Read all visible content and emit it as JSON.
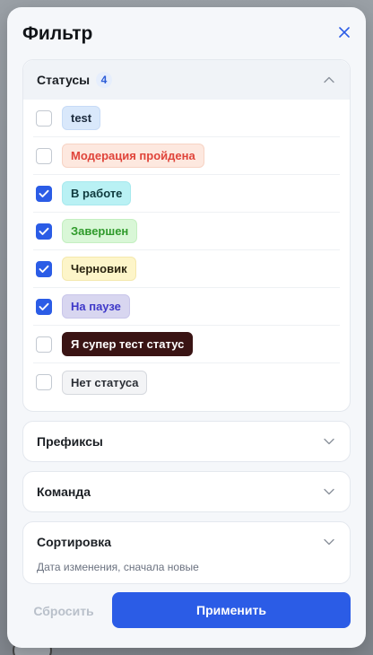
{
  "modal": {
    "title": "Фильтр",
    "close_icon": "close-icon"
  },
  "statuses": {
    "label": "Статусы",
    "selected_count": "4",
    "expanded": true,
    "items": [
      {
        "label": "test",
        "checked": false,
        "bg": "#d9e8fb",
        "fg": "#1b2a3d",
        "border": "#c7dbf6"
      },
      {
        "label": "Модерация пройдена",
        "checked": false,
        "bg": "#fde8df",
        "fg": "#e0443a",
        "border": "#f7d3c4"
      },
      {
        "label": "В работе",
        "checked": true,
        "bg": "#b9f1f4",
        "fg": "#0f3a3e",
        "border": "#a7e9ee"
      },
      {
        "label": "Завершен",
        "checked": true,
        "bg": "#d9f7d7",
        "fg": "#2f9a2b",
        "border": "#c4efc1"
      },
      {
        "label": "Черновик",
        "checked": true,
        "bg": "#fdf5c9",
        "fg": "#2a2410",
        "border": "#f4e8ad"
      },
      {
        "label": "На паузе",
        "checked": true,
        "bg": "#d8d6f0",
        "fg": "#3f39c9",
        "border": "#c9c6ea"
      },
      {
        "label": "Я супер тест статус",
        "checked": false,
        "bg": "#3a1414",
        "fg": "#ffffff",
        "border": "#3a1414"
      },
      {
        "label": "Нет статуса",
        "checked": false,
        "bg": "#f3f4f6",
        "fg": "#2b2f36",
        "border": "#d6d9de"
      }
    ]
  },
  "prefixes": {
    "label": "Префиксы",
    "expanded": false
  },
  "team": {
    "label": "Команда",
    "expanded": false
  },
  "sorting": {
    "label": "Сортировка",
    "value": "Дата изменения, сначала новые",
    "expanded": false
  },
  "footer": {
    "reset_label": "Сбросить",
    "apply_label": "Применить"
  },
  "colors": {
    "accent": "#2b5ce6",
    "checkbox_checked": "#2b5ce6"
  }
}
